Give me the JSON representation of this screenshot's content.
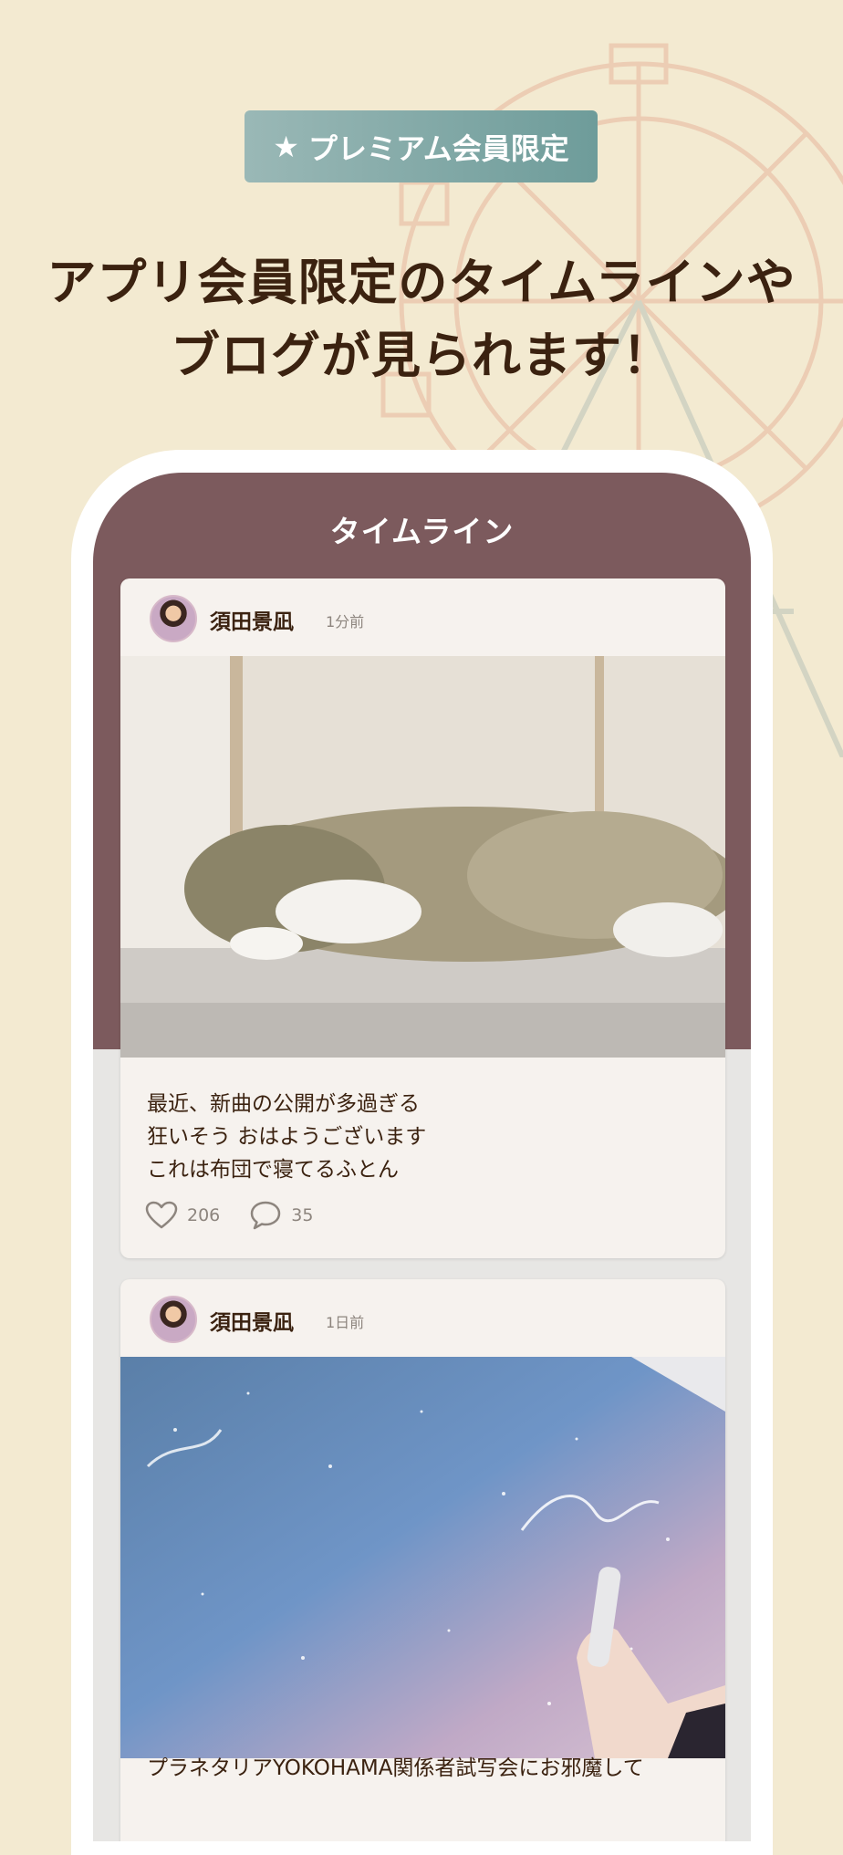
{
  "badge": {
    "icon": "star-icon",
    "label": "プレミアム会員限定"
  },
  "headline": {
    "line1": "アプリ会員限定のタイムラインや",
    "line2": "ブログが見られます！"
  },
  "screen": {
    "title": "タイムライン"
  },
  "posts": [
    {
      "username": "須田景凪",
      "time": "1分前",
      "image": "sleeping-cat-photo",
      "text_lines": [
        "最近、新曲の公開が多過ぎる",
        "狂いそう おはようございます",
        "これは布団で寝てるふとん"
      ],
      "likes": "206",
      "comments": "35"
    },
    {
      "username": "須田景凪",
      "time": "1日前",
      "image": "starry-sky-autograph-photo",
      "text_lines": [
        "プラネタリアYOKOHAMA関係者試写会にお邪魔して"
      ]
    }
  ],
  "colors": {
    "background": "#f3ead1",
    "header": "#7c5a5d",
    "badge": "#7fa7a5",
    "text": "#3b2210"
  }
}
